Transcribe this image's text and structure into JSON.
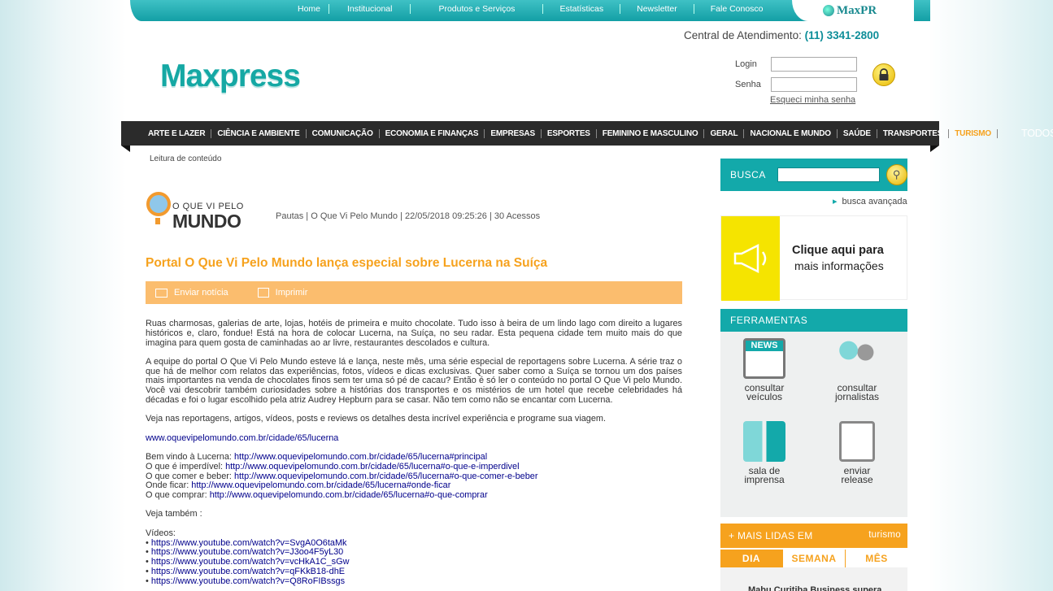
{
  "topnav": {
    "items": [
      "Home",
      "Institucional",
      "Produtos e Serviços",
      "Estatísticas",
      "Newsletter",
      "Fale Conosco"
    ],
    "maxpr": "MaxPR"
  },
  "header": {
    "central_label": "Central de Atendimento:",
    "central_phone": "(11) 3341-2800",
    "logo": "Maxpress",
    "login_label": "Login",
    "senha_label": "Senha",
    "forgot": "Esqueci minha senha"
  },
  "categories": [
    "ARTE E LAZER",
    "CIÊNCIA E AMBIENTE",
    "COMUNICAÇÃO",
    "ECONOMIA E FINANÇAS",
    "EMPRESAS",
    "ESPORTES",
    "FEMININO E MASCULINO",
    "GERAL",
    "NACIONAL E MUNDO",
    "SAÚDE",
    "TRANSPORTES",
    "TURISMO"
  ],
  "categories_all": "TODOS",
  "breadcrumb": "Leitura de conteúdo",
  "publisher": {
    "logo_top": "O QUE VI PELO",
    "logo_bottom": "MUNDO"
  },
  "article": {
    "meta": "Pautas | O Que Vi Pelo Mundo | 22/05/2018 09:25:26 | 30 Acessos",
    "title": "Portal O Que Vi Pelo Mundo lança especial sobre Lucerna na Suíça",
    "send": "Enviar notícia",
    "print": "Imprimir",
    "p1": "Ruas charmosas, galerias de arte, lojas, hotéis de primeira e muito chocolate. Tudo isso à beira de um lindo lago com direito a lugares históricos e, claro, fondue! Está na hora de colocar Lucerna, na Suíça, no seu radar. Esta pequena cidade tem muito mais do que imagina para quem gosta de caminhadas ao ar livre, restaurantes descolados e cultura.",
    "p2": "A equipe do portal O Que Vi Pelo Mundo esteve lá e lança, neste mês, uma série especial de reportagens sobre Lucerna. A série traz o que há de melhor com relatos das experiências, fotos, vídeos e dicas exclusivas. Quer saber como a Suíça se tornou um dos países mais importantes na venda de chocolates finos sem ter uma só pé de cacau? Então é só ler o conteúdo no portal O Que Vi pelo Mundo. Você vai descobrir também curiosidades sobre a histórias dos transportes e os mistérios de um hotel que recebe celebridades há décadas e foi o lugar escolhido pela atriz Audrey Hepburn para se casar. Não tem como não se encantar com Lucerna.",
    "p3": "Veja nas reportagens, artigos, vídeos, posts e reviews os detalhes desta incrível experiência e programe sua viagem.",
    "main_link": "www.oquevipelomundo.com.br/cidade/65/lucerna",
    "links": [
      {
        "label": " Bem vindo à Lucerna: ",
        "url": "http://www.oquevipelomundo.com.br/cidade/65/lucerna#principal"
      },
      {
        "label": "O que é imperdível: ",
        "url": "http://www.oquevipelomundo.com.br/cidade/65/lucerna#o-que-e-imperdivel"
      },
      {
        "label": "O que comer e beber: ",
        "url": "http://www.oquevipelomundo.com.br/cidade/65/lucerna#o-que-comer-e-beber"
      },
      {
        "label": "Onde ficar: ",
        "url": "http://www.oquevipelomundo.com.br/cidade/65/lucerna#onde-ficar"
      },
      {
        "label": "O que comprar: ",
        "url": "http://www.oquevipelomundo.com.br/cidade/65/lucerna#o-que-comprar"
      }
    ],
    "see_also": "Veja também :",
    "videos_label": "Vídeos:",
    "videos": [
      "https://www.youtube.com/watch?v=SvgA0O6taMk",
      "https://www.youtube.com/watch?v=J3oo4F5yL30",
      "https://www.youtube.com/watch?v=vcHkA1C_sGw",
      "https://www.youtube.com/watch?v=qFKkB18-dhE",
      "https://www.youtube.com/watch?v=Q8RoFIBssgs"
    ]
  },
  "sidebar": {
    "busca": "BUSCA",
    "busca_avancada": "busca avançada",
    "banner_line1": "Clique aqui para",
    "banner_line2": "mais informações",
    "ferramentas": "FERRAMENTAS",
    "news_badge": "NEWS",
    "tools": [
      {
        "l1": "consultar",
        "l2": "veículos"
      },
      {
        "l1": "consultar",
        "l2": "jornalistas"
      },
      {
        "l1": "sala de",
        "l2": "imprensa"
      },
      {
        "l1": "enviar",
        "l2": "release"
      }
    ],
    "mais_lidas": "+ MAIS LIDAS EM",
    "mais_lidas_topic": "turismo",
    "tabs": [
      "DIA",
      "SEMANA",
      "MÊS"
    ],
    "lidas_first": "Mabu Curitiba Business supera"
  },
  "colors": {
    "teal": "#13a9aa",
    "orange": "#f6a21e",
    "light_orange": "#fbbd6e"
  }
}
